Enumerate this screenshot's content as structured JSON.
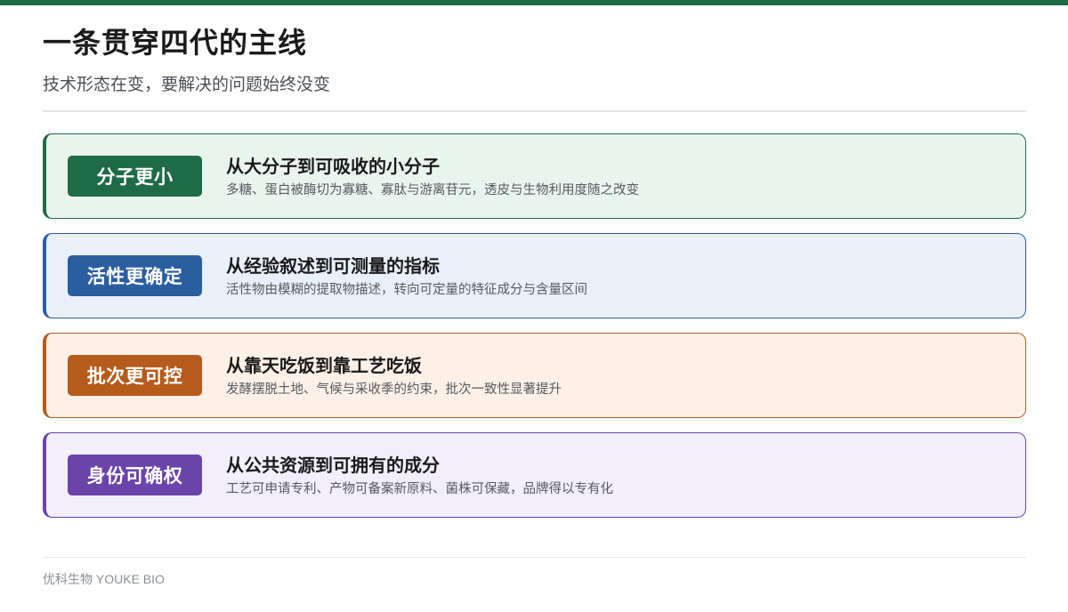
{
  "colors": {
    "accent_bar": "#1f6b47",
    "divider": "#e3e5e8"
  },
  "header": {
    "title": "一条贯穿四代的主线",
    "subtitle": "技术形态在变，要解决的问题始终没变"
  },
  "rows": [
    {
      "badge": "分子更小",
      "heading": "从大分子到可吸收的小分子",
      "description": "多糖、蛋白被酶切为寡糖、寡肽与游离苷元，透皮与生物利用度随之改变",
      "color": "#1f6b47",
      "bg": "#eaf4ee",
      "border": "#1f6b47"
    },
    {
      "badge": "活性更确定",
      "heading": "从经验叙述到可测量的指标",
      "description": "活性物由模糊的提取物描述，转向可定量的特征成分与含量区间",
      "color": "#2a5ea0",
      "bg": "#e9f0fa",
      "border": "#2a5ea0"
    },
    {
      "badge": "批次更可控",
      "heading": "从靠天吃饭到靠工艺吃饭",
      "description": "发酵摆脱土地、气候与采收季的约束，批次一致性显著提升",
      "color": "#b55b1c",
      "bg": "#fcf0e7",
      "border": "#b55b1c"
    },
    {
      "badge": "身份可确权",
      "heading": "从公共资源到可拥有的成分",
      "description": "工艺可申请专利、产物可备案新原料、菌株可保藏，品牌得以专有化",
      "color": "#6a44a8",
      "bg": "#f2eefb",
      "border": "#6a44a8"
    }
  ],
  "footer": {
    "brand": "优科生物 YOUKE BIO"
  }
}
